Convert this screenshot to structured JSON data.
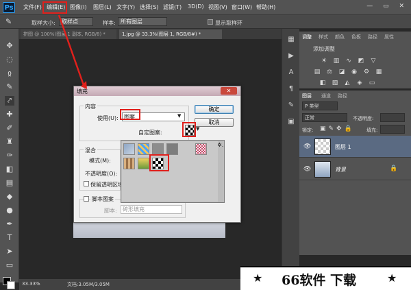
{
  "menu": {
    "logo": "Ps",
    "items": [
      "文件(F)",
      "编辑(E)",
      "图像(I)",
      "图层(L)",
      "文字(Y)",
      "选择(S)",
      "滤镜(T)",
      "3D(D)",
      "视图(V)",
      "窗口(W)",
      "帮助(H)"
    ],
    "window_controls": "— ▭ ✕"
  },
  "options": {
    "sample_size_label": "取样大小:",
    "sample_size_value": "取样点",
    "sample_label": "样本:",
    "sample_value": "所有图层",
    "show_ring_label": "显示取样环"
  },
  "tabs": [
    "拼图 @ 100%(图层 1 副本, RGB/8) *",
    "1.jpg @ 33.3%(图层 1, RGB/8#) *"
  ],
  "status": {
    "zoom": "33.33%",
    "doc": "文档:3.05M/3.05M"
  },
  "adjust_panel": {
    "tabs": [
      "调整",
      "样式",
      "颜色",
      "色板",
      "路径",
      "属性"
    ],
    "title": "添加调整"
  },
  "layers_panel": {
    "tabs": [
      "图层",
      "通道",
      "路径"
    ],
    "filter": "P 类型",
    "blend_mode": "正常",
    "opacity_label": "不透明度:",
    "lock_label": "锁定:",
    "fill_label": "填充:",
    "layers": [
      {
        "name": "图层 1",
        "selected": true
      },
      {
        "name": "背景",
        "selected": false
      }
    ]
  },
  "fill_dialog": {
    "title": "填充",
    "content_group": "内容",
    "use_label": "使用(U):",
    "use_value": "图案",
    "custom_pattern_label": "自定图案:",
    "ok_label": "确定",
    "cancel_label": "取消",
    "blend_group": "混合",
    "mode_label": "模式(M):",
    "opacity_label": "不透明度(O):",
    "preserve_label": "保留透明区域",
    "script_label": "脚本图案",
    "script_field_label": "脚本:",
    "script_value": "砖形填充",
    "picker_gear": "✲."
  },
  "watermark": {
    "text": "66软件 下载",
    "star": "★"
  },
  "colors": {
    "annotation_red": "#e0201c",
    "layer_selected": "#5a6a82",
    "ok_border": "#3c7fb1"
  },
  "icons": [
    "eyedropper-icon",
    "eye-icon",
    "lock-icon",
    "gear-icon",
    "dropdown-arrow-icon"
  ]
}
